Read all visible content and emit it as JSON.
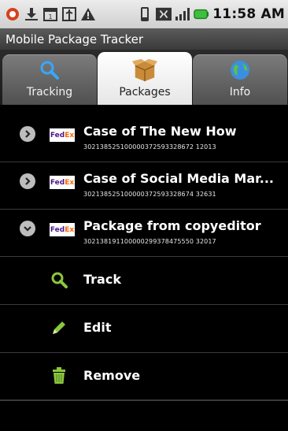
{
  "status_bar": {
    "time": "11:58 AM",
    "icons": [
      "notification-icon",
      "download-icon",
      "calendar-icon",
      "usb-icon",
      "warning-icon",
      "vibrate-icon",
      "signal-icon",
      "wifi-signal-icon",
      "battery-icon"
    ]
  },
  "app": {
    "title": "Mobile Package Tracker"
  },
  "tabs": [
    {
      "label": "Tracking",
      "icon": "search-icon",
      "selected": false
    },
    {
      "label": "Packages",
      "icon": "box-icon",
      "selected": true
    },
    {
      "label": "Info",
      "icon": "globe-icon",
      "selected": false
    }
  ],
  "packages": [
    {
      "carrier": "FedEx",
      "title": "Case of The New How",
      "tracking": "302138525100000372593328672 12013",
      "expanded": false
    },
    {
      "carrier": "FedEx",
      "title": "Case of Social Media Mar...",
      "tracking": "302138525100000372593328674 32631",
      "expanded": false
    },
    {
      "carrier": "FedEx",
      "title": "Package from copyeditor",
      "tracking": "302138191100000299378475550 32017",
      "expanded": true
    }
  ],
  "actions": [
    {
      "label": "Track",
      "icon": "search-icon"
    },
    {
      "label": "Edit",
      "icon": "pencil-icon"
    },
    {
      "label": "Remove",
      "icon": "trash-icon"
    }
  ],
  "colors": {
    "accent_green": "#8cc63f",
    "fedex_purple": "#4d148c",
    "fedex_orange": "#ff6600"
  }
}
